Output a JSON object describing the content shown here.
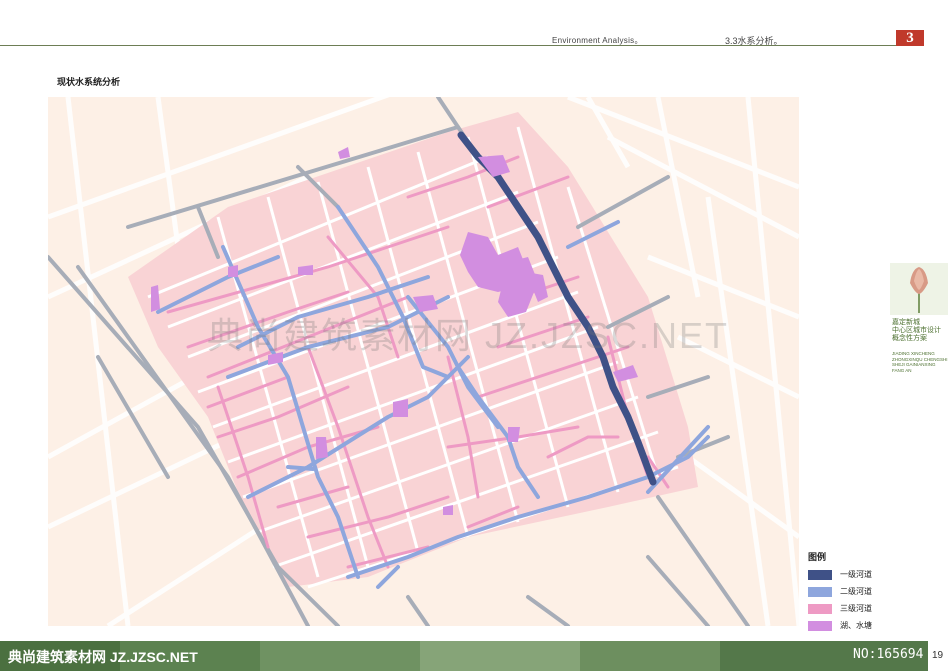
{
  "header": {
    "section_en": "Environment Analysis。",
    "section_cn": "3.3水系分析。",
    "chapter": "3"
  },
  "title": "现状水系统分析",
  "project": {
    "line1": "嘉定新城",
    "line2": "中心区城市设计",
    "line3": "概念性方案",
    "pinyin": "JIADING XINCHENG ZHONGXINQU CHENGSHI SHEJI GAINIANXING FANG AN"
  },
  "legend": {
    "title": "图例",
    "items": [
      {
        "label": "一级河道",
        "color": "#3f5187"
      },
      {
        "label": "二级河道",
        "color": "#8ea6dd"
      },
      {
        "label": "三级河道",
        "color": "#ee9ac4"
      },
      {
        "label": "湖、水塘",
        "color": "#d28ee0"
      }
    ]
  },
  "colors": {
    "map_bg": "#fdf0e6",
    "zone": "#f9d3d5",
    "road": "#ffffff",
    "road_gray": "#a7adb8"
  },
  "watermark": "典尚建筑素材网 JZ.JZSC.NET",
  "footer": {
    "left_text": "典尚建筑素材网 JZ.JZSC.NET",
    "right_text": "NO:165694",
    "page": "19"
  }
}
